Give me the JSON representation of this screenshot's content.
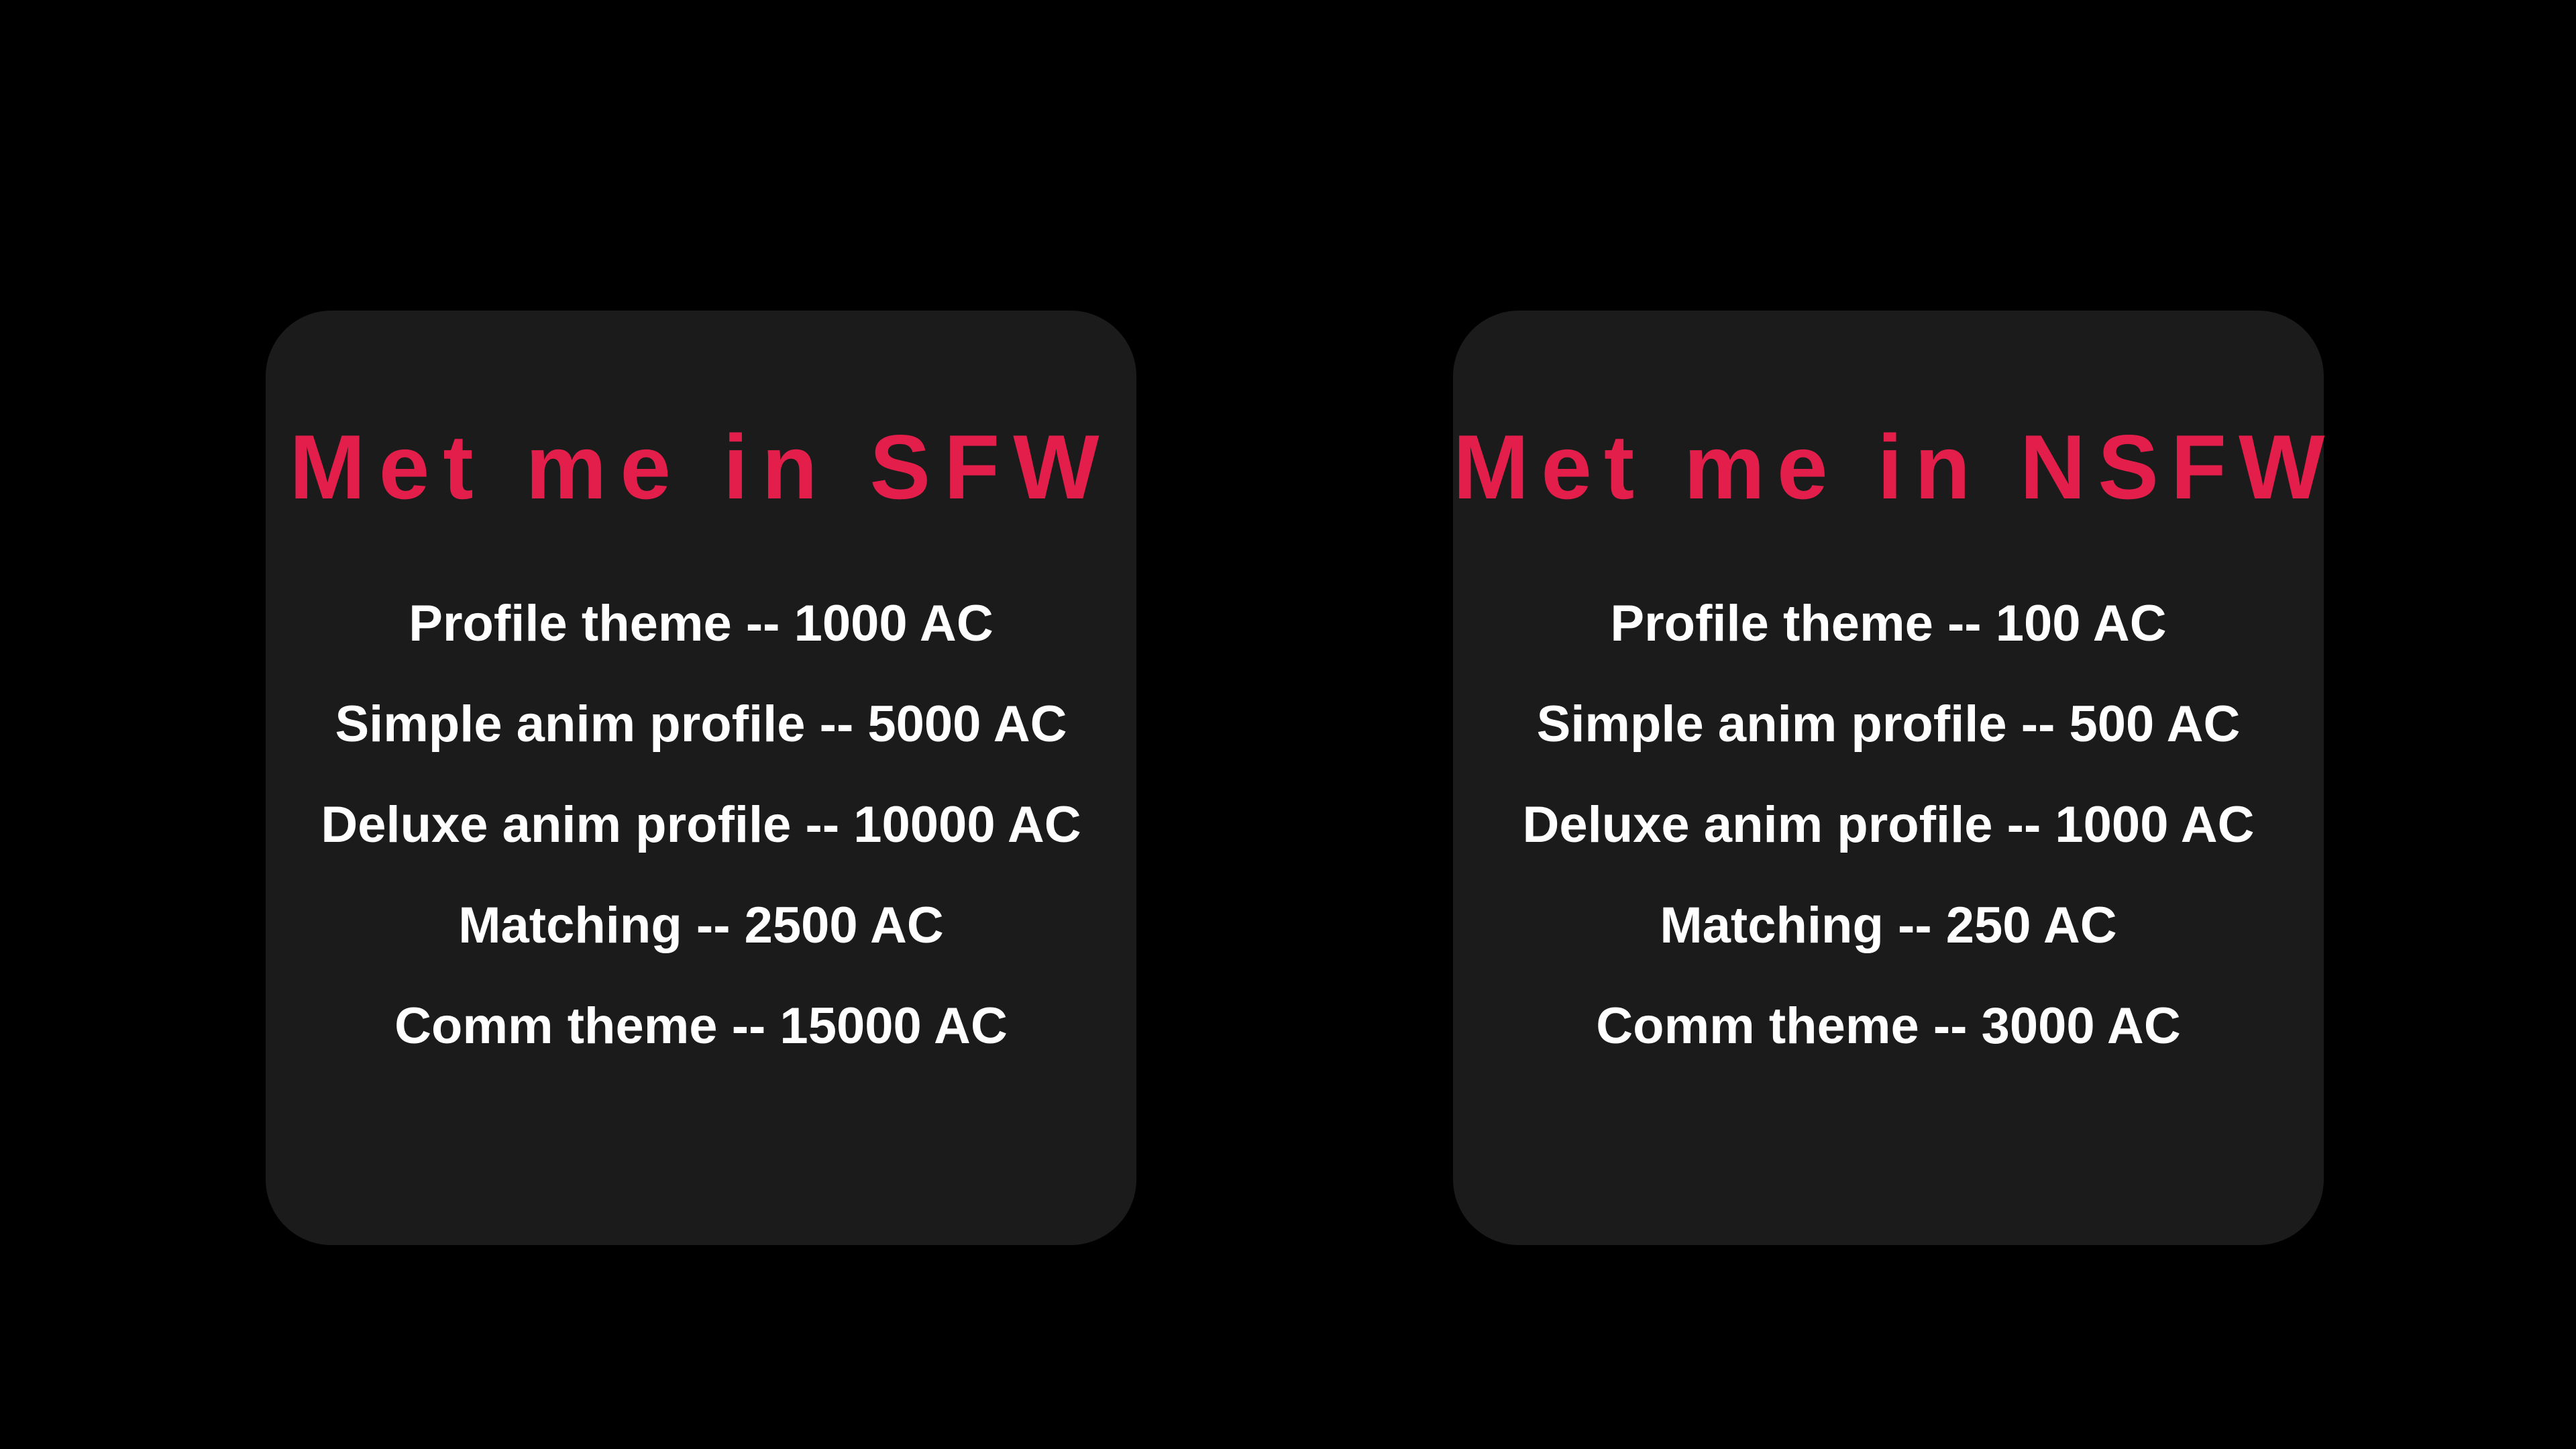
{
  "colors": {
    "background": "#000000",
    "card": "#1b1b1c",
    "accent": "#e31e4a",
    "text": "#ffffff"
  },
  "cards": [
    {
      "title": "Met me in SFW",
      "items": [
        "Profile theme -- 1000 AC",
        "Simple anim profile -- 5000 AC",
        "Deluxe anim profile -- 10000 AC",
        "Matching -- 2500 AC",
        "Comm theme -- 15000 AC"
      ]
    },
    {
      "title": "Met me in NSFW",
      "items": [
        "Profile theme -- 100 AC",
        "Simple anim profile -- 500 AC",
        "Deluxe anim profile -- 1000 AC",
        "Matching -- 250 AC",
        "Comm theme -- 3000 AC"
      ]
    }
  ]
}
